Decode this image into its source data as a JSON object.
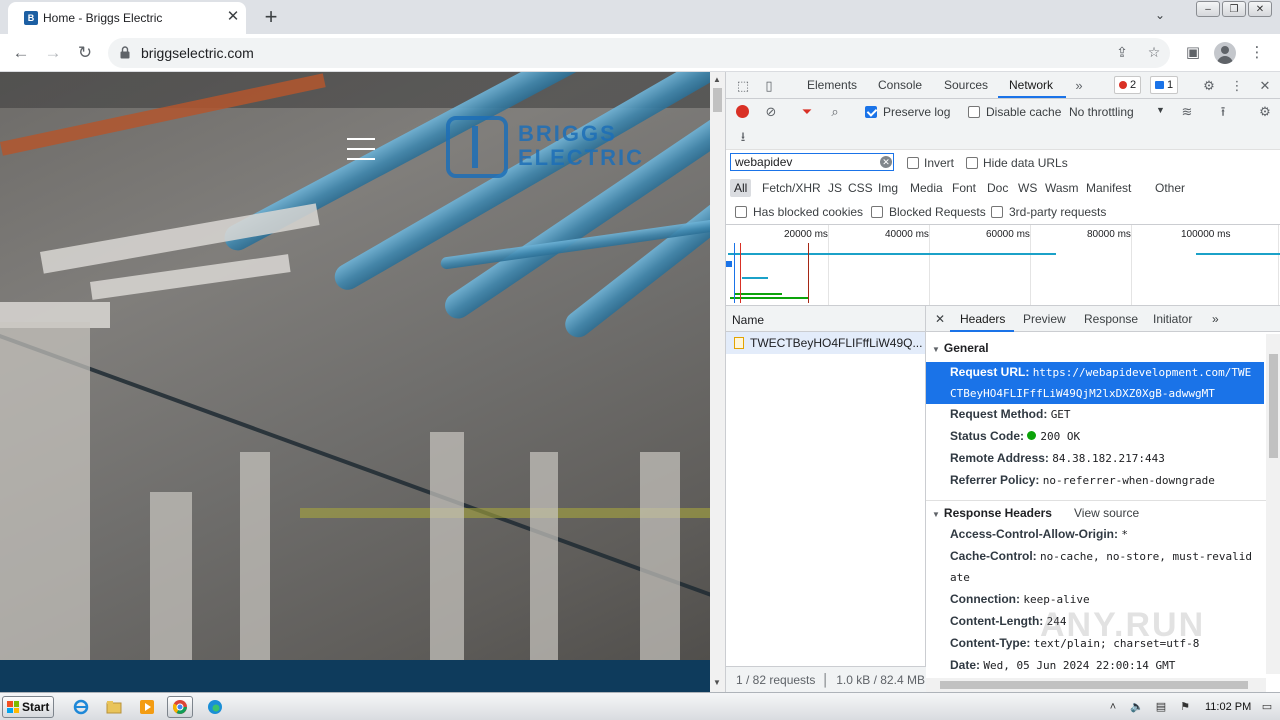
{
  "browser": {
    "tab_title": "Home - Briggs Electric",
    "tab_favicon_letter": "B",
    "url": "briggselectric.com"
  },
  "site": {
    "logo_line1": "BRIGGS",
    "logo_line2": "ELECTRIC",
    "brand_color": "#1d6fb8"
  },
  "devtools": {
    "panel_tabs": [
      "Elements",
      "Console",
      "Sources",
      "Network"
    ],
    "active_panel": "Network",
    "error_count": "2",
    "message_count": "1",
    "preserve_log_label": "Preserve log",
    "disable_cache_label": "Disable cache",
    "throttling": "No throttling",
    "filter_value": "webapidev",
    "invert_label": "Invert",
    "hide_data_urls_label": "Hide data URLs",
    "type_filters": [
      "All",
      "Fetch/XHR",
      "JS",
      "CSS",
      "Img",
      "Media",
      "Font",
      "Doc",
      "WS",
      "Wasm",
      "Manifest",
      "Other"
    ],
    "active_type_filter": "All",
    "blocked_cookies_label": "Has blocked cookies",
    "blocked_requests_label": "Blocked Requests",
    "third_party_label": "3rd-party requests",
    "timeline_labels": [
      "20000 ms",
      "40000 ms",
      "60000 ms",
      "80000 ms",
      "100000 ms"
    ],
    "name_column": "Name",
    "request_name": "TWECTBeyHO4FLIFffLiW49Q...",
    "summary_requests": "1 / 82 requests",
    "summary_size": "1.0 kB / 82.4 MB",
    "detail_tabs": [
      "Headers",
      "Preview",
      "Response",
      "Initiator"
    ],
    "active_detail_tab": "Headers",
    "general_title": "General",
    "general": {
      "request_url_key": "Request URL:",
      "request_url_line1": "https://webapidevelopment.com/TWE",
      "request_url_line2": "CTBeyHO4FLIFffLiW49QjM2lxDXZ0XgB-adwwgMT",
      "request_method_key": "Request Method:",
      "request_method": "GET",
      "status_code_key": "Status Code:",
      "status_code": "200 OK",
      "remote_address_key": "Remote Address:",
      "remote_address": "84.38.182.217:443",
      "referrer_policy_key": "Referrer Policy:",
      "referrer_policy": "no-referrer-when-downgrade"
    },
    "response_headers_title": "Response Headers",
    "view_source_label": "View source",
    "response_headers": {
      "acao_key": "Access-Control-Allow-Origin:",
      "acao": "*",
      "cache_control_key": "Cache-Control:",
      "cache_control_line1": "no-cache, no-store, must-revalid",
      "cache_control_line2": "ate",
      "connection_key": "Connection:",
      "connection": "keep-alive",
      "content_length_key": "Content-Length:",
      "content_length": "244",
      "content_type_key": "Content-Type:",
      "content_type": "text/plain; charset=utf-8",
      "date_key": "Date:",
      "date": "Wed, 05 Jun 2024 22:00:14 GMT"
    }
  },
  "watermark": "ANY.RUN",
  "taskbar": {
    "start_label": "Start",
    "clock": "11:02 PM"
  }
}
